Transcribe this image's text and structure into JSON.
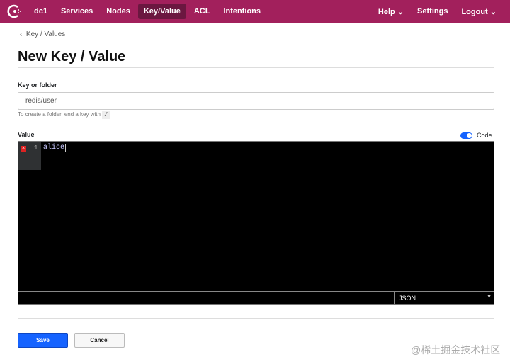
{
  "nav": {
    "dc": "dc1",
    "items": [
      "Services",
      "Nodes",
      "Key/Value",
      "ACL",
      "Intentions"
    ],
    "active": "Key/Value",
    "right": [
      "Help",
      "Settings",
      "Logout"
    ]
  },
  "breadcrumb": "Key / Values",
  "title": "New Key / Value",
  "key_field": {
    "label": "Key or folder",
    "value": "redis/user",
    "help": "To create a folder, end a key with",
    "help_code": "/"
  },
  "value": {
    "label": "Value",
    "toggle_label": "Code",
    "toggle_on": true,
    "line_number": "1",
    "code": "alice",
    "mode": "JSON"
  },
  "buttons": {
    "save": "Save",
    "cancel": "Cancel"
  },
  "watermark": "@稀土掘金技术社区",
  "colors": {
    "brand": "#a2205c",
    "primary": "#1563ff"
  }
}
